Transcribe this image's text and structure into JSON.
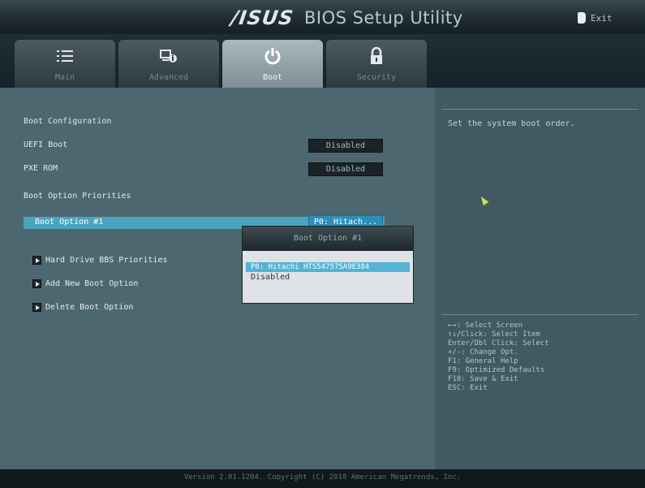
{
  "header": {
    "brand": "/ISUS",
    "title": "BIOS Setup Utility",
    "exit_label": "Exit"
  },
  "tabs": [
    {
      "label": "Main",
      "icon": "menu-icon"
    },
    {
      "label": "Advanced",
      "icon": "monitor-info-icon"
    },
    {
      "label": "Boot",
      "icon": "power-icon",
      "active": true
    },
    {
      "label": "Security",
      "icon": "lock-icon"
    }
  ],
  "boot": {
    "section_title": "Boot Configuration",
    "uefi_boot_label": "UEFI Boot",
    "uefi_boot_value": "Disabled",
    "pxe_rom_label": "PXE ROM",
    "pxe_rom_value": "Disabled",
    "priorities_title": "Boot Option Priorities",
    "boot_option1_label": "Boot Option #1",
    "boot_option1_value": "P0: Hitach...",
    "hdd_bbs_label": "Hard Drive BBS Priorities",
    "add_option_label": "Add New Boot Option",
    "delete_option_label": "Delete Boot Option"
  },
  "popup": {
    "title": "Boot Option #1",
    "options": [
      "P0: Hitachi HTS547575A9E384",
      "Disabled"
    ]
  },
  "help": {
    "text": "Set the system boot order.",
    "keys": [
      "←→: Select Screen",
      "↑↓/Click: Select Item",
      "Enter/Dbl Click: Select",
      "+/-: Change Opt.",
      "F1: General Help",
      "F9: Optimized Defaults",
      "F10: Save & Exit",
      "ESC: Exit"
    ]
  },
  "footer": {
    "version": "Version 2.01.1204. Copyright (C) 2010 American Megatrends, Inc."
  },
  "colors": {
    "highlight": "#4aa4c0",
    "selected_value": "#2c8fba",
    "panel_bg": "#4d6770"
  }
}
